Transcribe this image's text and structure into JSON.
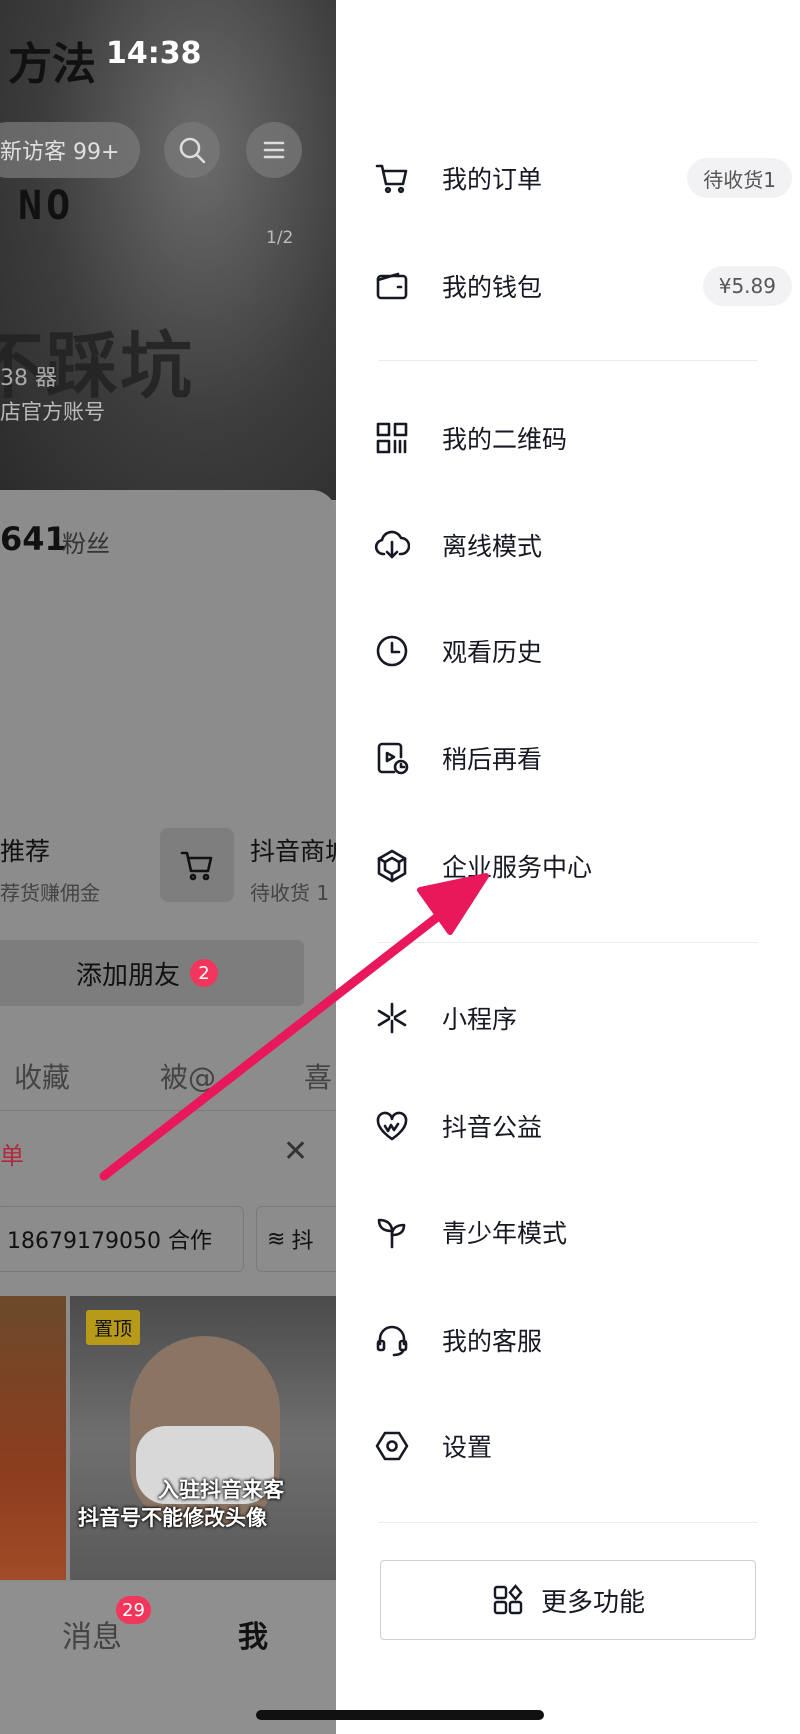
{
  "background": {
    "status_title": "方法",
    "status_time": "14:38",
    "visitors": "新访客 99+",
    "cover_art": "NO",
    "cover_big_text": "不踩坑",
    "page_indicator": "1/2",
    "small_meta": "38 器",
    "shop_account": "店官方账号",
    "fans_count": "641",
    "fans_label": "粉丝",
    "feature_left_title": "推荐",
    "feature_left_sub": "荐货赚佣金",
    "feature_right_title": "抖音商城",
    "feature_right_sub": "待收货 1",
    "add_friend": "添加朋友",
    "add_friend_badge": "2",
    "tabs": [
      "收藏",
      "被@",
      "喜"
    ],
    "list_text": "单",
    "chip1": "18679179050 合作",
    "chip2": "抖",
    "pinned": "置顶",
    "thumb_caption1": "入驻抖音来客",
    "thumb_caption2": "抖音号不能修改头像",
    "nav_messages": "消息",
    "nav_messages_badge": "29",
    "nav_me": "我"
  },
  "drawer": {
    "items": [
      {
        "label": "我的订单",
        "icon": "cart-icon",
        "pill": "待收货1"
      },
      {
        "label": "我的钱包",
        "icon": "wallet-icon",
        "pill": "¥5.89"
      },
      {
        "label": "我的二维码",
        "icon": "qrcode-icon"
      },
      {
        "label": "离线模式",
        "icon": "cloud-download-icon"
      },
      {
        "label": "观看历史",
        "icon": "clock-icon"
      },
      {
        "label": "稍后再看",
        "icon": "watch-later-icon"
      },
      {
        "label": "企业服务中心",
        "icon": "enterprise-icon"
      },
      {
        "label": "小程序",
        "icon": "mini-program-icon"
      },
      {
        "label": "抖音公益",
        "icon": "charity-heart-icon"
      },
      {
        "label": "青少年模式",
        "icon": "sprout-icon"
      },
      {
        "label": "我的客服",
        "icon": "headset-icon"
      },
      {
        "label": "设置",
        "icon": "settings-hexagon-icon"
      }
    ],
    "more_button": "更多功能"
  },
  "colors": {
    "drawer_bg": "#ffffff",
    "text": "#161823",
    "pill_bg": "#f2f2f4",
    "arrow": "#e8185a",
    "badge": "#f2355a"
  }
}
